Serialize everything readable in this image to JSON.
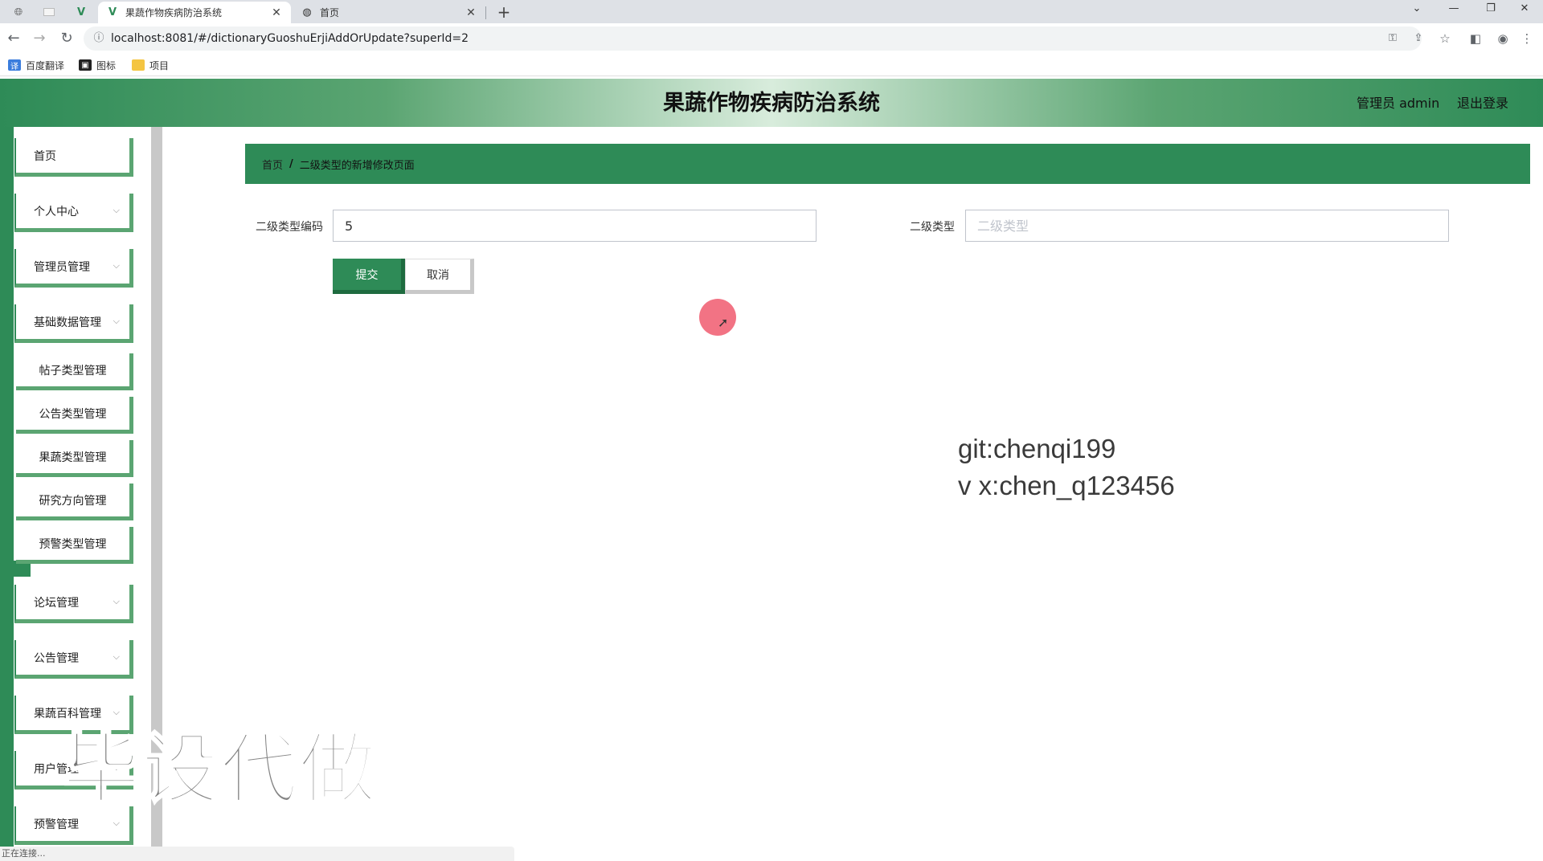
{
  "browser": {
    "tabs": [
      {
        "title": "果蔬作物疾病防治系统",
        "active": true,
        "icon": "vue-logo-icon"
      },
      {
        "title": "首页",
        "active": false,
        "icon": "globe-icon"
      }
    ],
    "url": "localhost:8081/#/dictionaryGuoshuErjiAddOrUpdate?superId=2",
    "bookmarks": [
      {
        "label": "百度翻译",
        "icon": "translate-icon"
      },
      {
        "label": "图标",
        "icon": "image-icon"
      },
      {
        "label": "项目",
        "icon": "folder-icon"
      }
    ]
  },
  "header": {
    "title": "果蔬作物疾病防治系统",
    "user": "管理员 admin",
    "logout": "退出登录"
  },
  "sidebar": {
    "items": [
      {
        "label": "首页"
      },
      {
        "label": "个人中心"
      },
      {
        "label": "管理员管理"
      },
      {
        "label": "基础数据管理"
      },
      {
        "label": "论坛管理"
      },
      {
        "label": "公告管理"
      },
      {
        "label": "果蔬百科管理"
      },
      {
        "label": "用户管理"
      },
      {
        "label": "预警管理"
      }
    ],
    "subitems": [
      {
        "label": "帖子类型管理"
      },
      {
        "label": "公告类型管理"
      },
      {
        "label": "果蔬类型管理"
      },
      {
        "label": "研究方向管理"
      },
      {
        "label": "预警类型管理"
      }
    ]
  },
  "breadcrumb": {
    "home": "首页",
    "separator": "/",
    "current": "二级类型的新增修改页面"
  },
  "form": {
    "code_label": "二级类型编码",
    "code_value": "5",
    "type_label": "二级类型",
    "type_placeholder": "二级类型",
    "submit": "提交",
    "cancel": "取消"
  },
  "overlay": {
    "git": "git:chenqi199",
    "vx": "v x:chen_q123456",
    "big": "毕设代做"
  },
  "status": {
    "text": "正在连接..."
  },
  "colors": {
    "primary_green": "#2e8b57",
    "light_green": "#5ba572",
    "cursor_highlight": "#f05a6e"
  }
}
